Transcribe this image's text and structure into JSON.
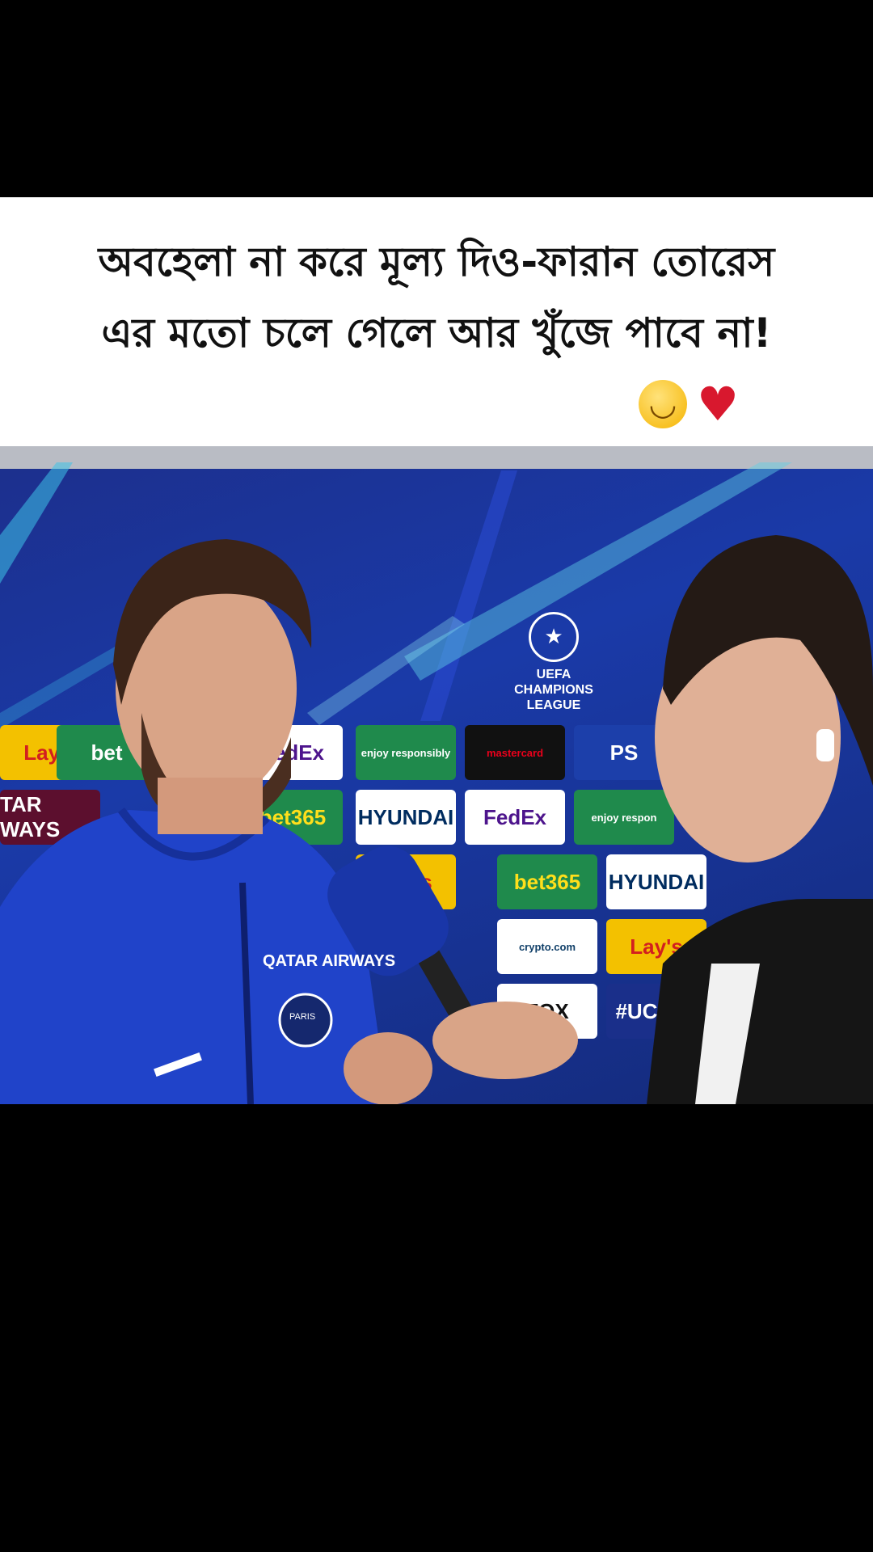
{
  "caption": {
    "line1": "অবহেলা না করে মূল্য দিও-ফারান তোরেস",
    "line2": "এর মতো চলে গেলে আর খুঁজে পাবে না!"
  },
  "emojis": [
    "relieved-face",
    "mending-heart"
  ],
  "video": {
    "ucl_logo_lines": [
      "UEFA",
      "CHAMPIONS",
      "LEAGUE"
    ],
    "sponsor_boards": [
      {
        "text": "Lay's",
        "bg": "#f3c100",
        "fg": "#d21f1f"
      },
      {
        "text": "bet",
        "bg": "#1f8a4c",
        "fg": "#ffffff"
      },
      {
        "text": "FedEx",
        "bg": "#ffffff",
        "fg": "#4d148c"
      },
      {
        "text": "enjoy responsibly",
        "bg": "#1f8a4c",
        "fg": "#ffffff"
      },
      {
        "text": "mastercard",
        "bg": "#111111",
        "fg": "#eb001b"
      },
      {
        "text": "PS",
        "bg": "#1c3faa",
        "fg": "#ffffff"
      },
      {
        "text": "TAR WAYS",
        "bg": "#5c0f2e",
        "fg": "#ffffff"
      },
      {
        "text": "bet365",
        "bg": "#1f8a4c",
        "fg": "#ffdf1b"
      },
      {
        "text": "HYUNDAI",
        "bg": "#ffffff",
        "fg": "#002c5f"
      },
      {
        "text": "FedEx",
        "bg": "#ffffff",
        "fg": "#4d148c"
      },
      {
        "text": "enjoy respon",
        "bg": "#1f8a4c",
        "fg": "#ffffff"
      },
      {
        "text": "Lay's",
        "bg": "#f3c100",
        "fg": "#d21f1f"
      },
      {
        "text": "bet365",
        "bg": "#1f8a4c",
        "fg": "#ffdf1b"
      },
      {
        "text": "HYUNDAI",
        "bg": "#ffffff",
        "fg": "#002c5f"
      },
      {
        "text": "crypto.com",
        "bg": "#ffffff",
        "fg": "#103f68"
      },
      {
        "text": "Lay's",
        "bg": "#f3c100",
        "fg": "#d21f1f"
      },
      {
        "text": "FOX",
        "bg": "#ffffff",
        "fg": "#111111"
      },
      {
        "text": "#UCLFE",
        "bg": "#1a2f8a",
        "fg": "#ffffff"
      }
    ],
    "jacket_text": "QATAR AIRWAYS",
    "badge_text": "PARIS"
  },
  "colors": {
    "background": "#000000",
    "caption_bg": "#ffffff",
    "caption_text": "#111111",
    "ucl_blue": "#1a3aa8"
  }
}
